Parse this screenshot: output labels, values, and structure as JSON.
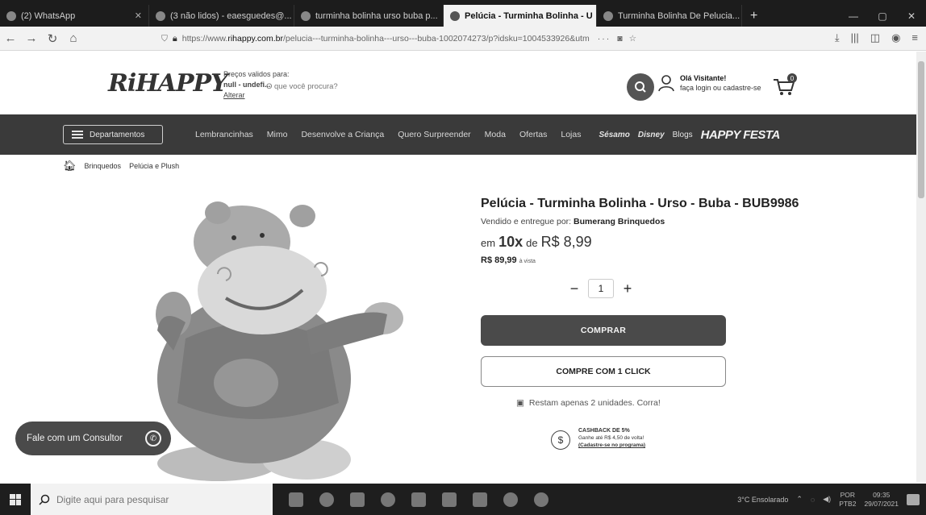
{
  "browser": {
    "tabs": [
      {
        "label": "(2) WhatsApp",
        "active": false
      },
      {
        "label": "(3 não lidos) - eaesguedes@...",
        "active": false
      },
      {
        "label": "turminha bolinha urso buba p...",
        "active": false
      },
      {
        "label": "Pelúcia - Turminha Bolinha - U",
        "active": true
      },
      {
        "label": "Turminha Bolinha De Pelucia...",
        "active": false
      }
    ],
    "url_prefix": "https://www.",
    "url_domain": "rihappy.com.br",
    "url_rest": "/pelucia---turminha-bolinha---urso---buba-1002074273/p?idsku=1004533926&utm",
    "url_extra": "···"
  },
  "header": {
    "logo": "RiHAPPY",
    "prices_label": "Preços validos para:",
    "prices_value": "null - undefi...",
    "prices_change": "Alterar",
    "search_placeholder": "O que você procura?",
    "user_greeting": "Olá Visitante!",
    "user_sub": "faça login ou cadastre-se",
    "cart_count": "0"
  },
  "nav": {
    "departments": "Departamentos",
    "items": [
      "Lembrancinhas",
      "Mimo",
      "Desenvolve a Criança",
      "Quero Surpreender",
      "Moda",
      "Ofertas",
      "Lojas"
    ],
    "brands": [
      "Sésamo",
      "Disney",
      "Blogs",
      "HAPPY FESTA"
    ]
  },
  "breadcrumb": [
    "Brinquedos",
    "Pelúcia e Plush"
  ],
  "product": {
    "title": "Pelúcia - Turminha Bolinha - Urso - Buba - BUB9986",
    "seller_label": "Vendido e entregue por:",
    "seller": "Bumerang Brinquedos",
    "inst_prefix": "em",
    "inst_count": "10x",
    "inst_de": "de",
    "inst_price": "R$ 8,99",
    "cash_price": "R$ 89,99",
    "cash_label": "à vista",
    "quantity": "1",
    "buy_label": "COMPRAR",
    "oneclick_label": "COMPRE COM 1 CLICK",
    "stock_note": "Restam apenas 2 unidades. Corra!",
    "cashback_title": "CASHBACK DE 5%",
    "cashback_text": "Ganhe até R$ 4,50 de volta!",
    "cashback_link": "(Cadastre-se no programa)"
  },
  "chat": {
    "label": "Fale com um Consultor"
  },
  "taskbar": {
    "search_placeholder": "Digite aqui para pesquisar",
    "weather": "3°C Ensolarado",
    "lang": "POR",
    "lang2": "PTB2",
    "time": "09:35",
    "date": "29/07/2021"
  }
}
